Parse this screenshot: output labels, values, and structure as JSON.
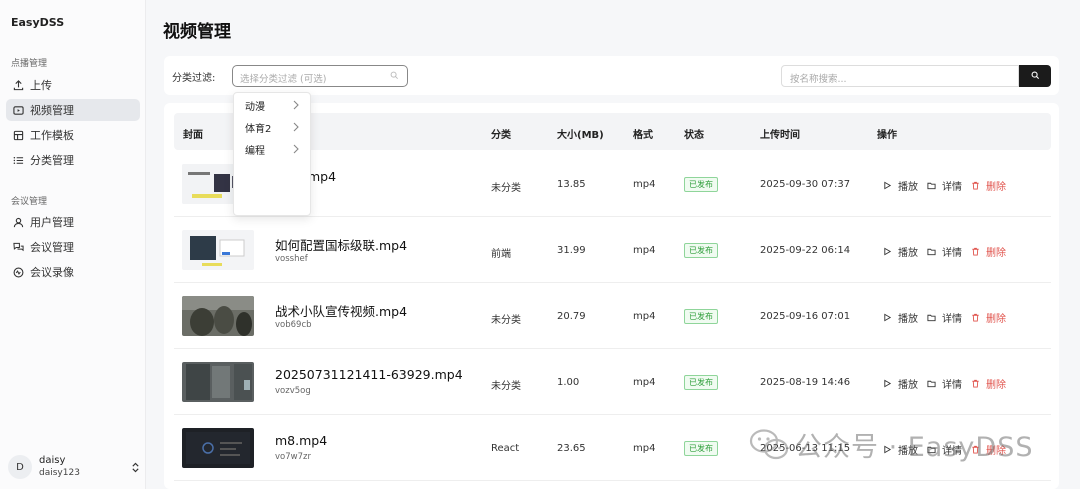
{
  "app": {
    "brand": "EasyDSS"
  },
  "sidebar": {
    "section1": "点播管理",
    "section2": "会议管理",
    "items": [
      {
        "label": "上传",
        "icon": "upload-icon"
      },
      {
        "label": "视频管理",
        "icon": "video-icon"
      },
      {
        "label": "工作模板",
        "icon": "template-icon"
      },
      {
        "label": "分类管理",
        "icon": "list-icon"
      },
      {
        "label": "用户管理",
        "icon": "user-icon"
      },
      {
        "label": "会议管理",
        "icon": "meeting-icon"
      },
      {
        "label": "会议录像",
        "icon": "record-icon"
      }
    ],
    "user": {
      "avatar_letter": "D",
      "name": "daisy",
      "id": "daisy123"
    }
  },
  "page": {
    "title": "视频管理"
  },
  "filter": {
    "label": "分类过滤:",
    "placeholder": "选择分类过滤 (可选)",
    "search_placeholder": "按名称搜索..."
  },
  "dropdown": {
    "options": [
      "动漫",
      "体育2",
      "编程"
    ]
  },
  "table": {
    "headers": {
      "cover": "封面",
      "category": "分类",
      "size": "大小(MB)",
      "format": "格式",
      "status": "状态",
      "upload_time": "上传时间",
      "actions": "操作"
    },
    "actions": {
      "play": "播放",
      "detail": "详情",
      "delete": "删除"
    },
    "rows": [
      {
        "name": "mp4",
        "id": "",
        "category": "未分类",
        "size": "13.85",
        "format": "mp4",
        "status": "已发布",
        "time": "2025-09-30 07:37"
      },
      {
        "name": "如何配置国标级联.mp4",
        "id": "vosshef",
        "category": "前端",
        "size": "31.99",
        "format": "mp4",
        "status": "已发布",
        "time": "2025-09-22 06:14"
      },
      {
        "name": "战术小队宣传视频.mp4",
        "id": "vob69cb",
        "category": "未分类",
        "size": "20.79",
        "format": "mp4",
        "status": "已发布",
        "time": "2025-09-16 07:01"
      },
      {
        "name": "20250731121411-63929.mp4",
        "id": "vozv5og",
        "category": "未分类",
        "size": "1.00",
        "format": "mp4",
        "status": "已发布",
        "time": "2025-08-19 14:46"
      },
      {
        "name": "m8.mp4",
        "id": "vo7w7zr",
        "category": "React",
        "size": "23.65",
        "format": "mp4",
        "status": "已发布",
        "time": "2025-06-13 11:15"
      }
    ]
  },
  "watermark": {
    "text": "公众号 · EasyDSS"
  }
}
